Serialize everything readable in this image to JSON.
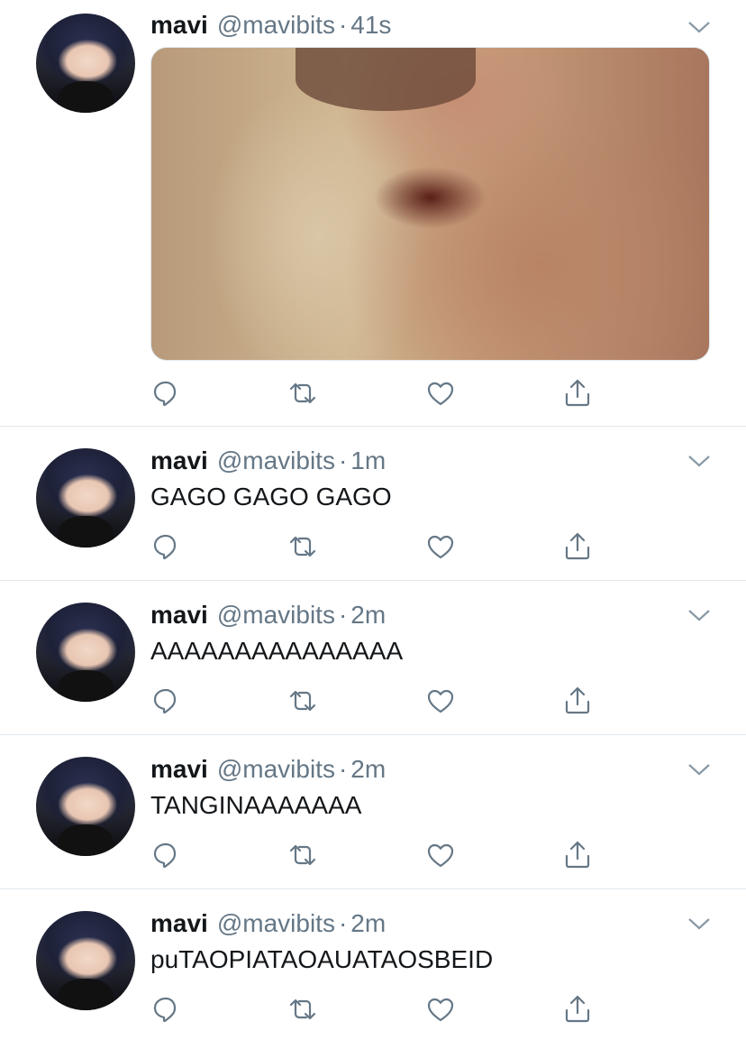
{
  "tweets": [
    {
      "name": "mavi",
      "handle": "@mavibits",
      "separator": "·",
      "time": "41s",
      "text": "",
      "has_media": true
    },
    {
      "name": "mavi",
      "handle": "@mavibits",
      "separator": "·",
      "time": "1m",
      "text": "GAGO GAGO GAGO",
      "has_media": false
    },
    {
      "name": "mavi",
      "handle": "@mavibits",
      "separator": "·",
      "time": "2m",
      "text": "AAAAAAAAAAAAAAA",
      "has_media": false
    },
    {
      "name": "mavi",
      "handle": "@mavibits",
      "separator": "·",
      "time": "2m",
      "text": "TANGINAAAAAAA",
      "has_media": false
    },
    {
      "name": "mavi",
      "handle": "@mavibits",
      "separator": "·",
      "time": "2m",
      "text": "puTAOPIATAOAUATAOSBEID",
      "has_media": false
    }
  ],
  "icons": {
    "reply": "reply-icon",
    "retweet": "retweet-icon",
    "like": "heart-icon",
    "share": "share-icon",
    "menu": "chevron-down-icon"
  },
  "colors": {
    "text": "#14171a",
    "secondary": "#657786",
    "divider": "#e1e8ed"
  }
}
